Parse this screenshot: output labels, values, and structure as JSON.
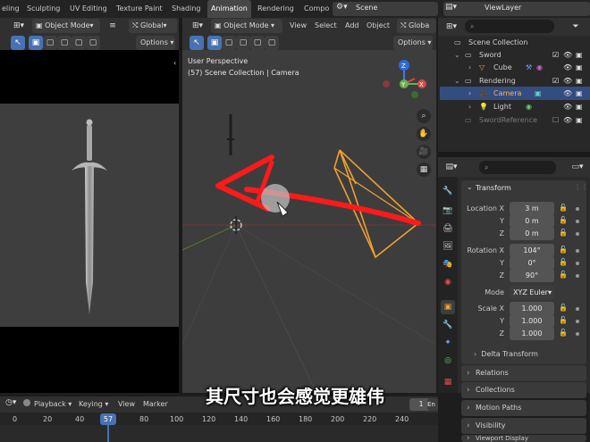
{
  "top_tabs": [
    {
      "label": "eling",
      "active": false
    },
    {
      "label": "Sculpting",
      "active": false
    },
    {
      "label": "UV Editing",
      "active": false
    },
    {
      "label": "Texture Paint",
      "active": false
    },
    {
      "label": "Shading",
      "active": false
    },
    {
      "label": "Animation",
      "active": true
    },
    {
      "label": "Rendering",
      "active": false
    },
    {
      "label": "Compo",
      "active": false
    }
  ],
  "scene_name": "Scene",
  "view_layer": "ViewLayer",
  "left_view": {
    "mode_label": "Object Mode",
    "orientation": "Global",
    "options_label": "Options"
  },
  "main_view": {
    "mode_label": "Object Mode",
    "menus": [
      "View",
      "Select",
      "Add",
      "Object"
    ],
    "orientation": "Globa",
    "options_label": "Options",
    "perspective_label": "User Perspective",
    "collection_label": "(57) Scene Collection | Camera"
  },
  "outliner": {
    "rows": [
      {
        "label": "Scene Collection",
        "selected": false,
        "muted": false
      },
      {
        "label": "Sword",
        "selected": false,
        "muted": false
      },
      {
        "label": "Cube",
        "selected": false,
        "muted": false
      },
      {
        "label": "Rendering",
        "selected": false,
        "muted": false
      },
      {
        "label": "Camera",
        "selected": true,
        "muted": false
      },
      {
        "label": "Light",
        "selected": false,
        "muted": false
      },
      {
        "label": "SwordReference",
        "selected": false,
        "muted": true
      }
    ]
  },
  "properties": {
    "section_title": "Transform",
    "location": {
      "label": "Location X",
      "x": "3 m",
      "y": "0 m",
      "z": "0 m"
    },
    "rotation": {
      "label": "Rotation X",
      "x": "104°",
      "y": "0°",
      "z": "90°"
    },
    "mode": {
      "label": "Mode",
      "value": "XYZ Euler"
    },
    "scale": {
      "label": "Scale X",
      "x": "1.000",
      "y": "1.000",
      "z": "1.000"
    },
    "axis_labels": {
      "y": "Y",
      "z": "Z"
    },
    "delta_transform": "Delta Transform",
    "collapsed_panels": [
      "Relations",
      "Collections",
      "Motion Paths",
      "Visibility"
    ],
    "partial_panel": "Viewport Display"
  },
  "timeline": {
    "menus": [
      "Playback",
      "Keying",
      "View",
      "Marker"
    ],
    "current_frame": "57",
    "end_label": "En",
    "frame_one": "1",
    "ticks": [
      "0",
      "20",
      "40",
      "80",
      "100",
      "120",
      "140",
      "160",
      "180",
      "200",
      "220",
      "240"
    ]
  },
  "subtitle": "其尺寸也会感觉更雄伟",
  "gizmo": {
    "x_label": "X",
    "y_label": "Y",
    "z_label": "Z"
  },
  "colors": {
    "accent": "#4772b3",
    "annotation": "#ff1a1a",
    "camera": "#f0a030"
  }
}
